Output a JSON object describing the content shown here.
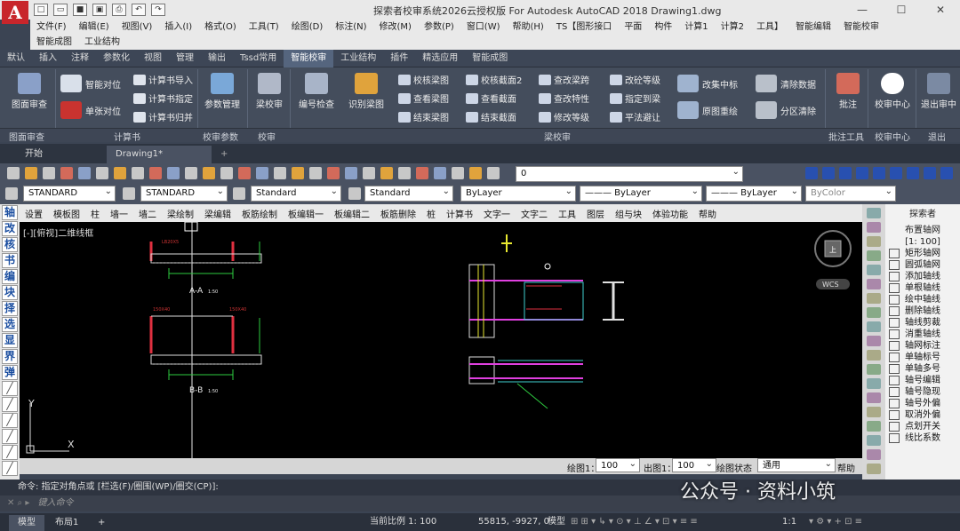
{
  "title": {
    "app_letter": "A",
    "text": "探索者校审系统2026云授权版 For Autodesk AutoCAD 2018    Drawing1.dwg",
    "controls": [
      "—",
      "☐",
      "✕"
    ]
  },
  "menu": {
    "line1": [
      "文件(F)",
      "编辑(E)",
      "视图(V)",
      "插入(I)",
      "格式(O)",
      "工具(T)",
      "绘图(D)",
      "标注(N)",
      "修改(M)",
      "参数(P)",
      "窗口(W)",
      "帮助(H)",
      "TS【图形接口",
      "平面",
      "构件",
      "计算1",
      "计算2",
      "工具】",
      "智能编辑",
      "智能校审"
    ],
    "line2": [
      "智能成图",
      "工业结构"
    ]
  },
  "ribbon_tabs": [
    "默认",
    "插入",
    "注释",
    "参数化",
    "视图",
    "管理",
    "输出",
    "Tssd常用",
    "智能校审",
    "工业结构",
    "插件",
    "精选应用",
    "智能成图"
  ],
  "ribbon_active": "智能校审",
  "ribbon": {
    "b_tumian": "图面审查",
    "b_zhineng": "智能对位",
    "b_danzhang": "单张对位",
    "b_jsdr": "计算书导入",
    "b_jszd": "计算书指定",
    "b_jsgb": "计算书归并",
    "b_cscl": "参数管理",
    "b_liang": "梁校审",
    "b_bhjc": "编号检查",
    "b_sbl": "识别梁图",
    "b_xhlt": "校核梁图",
    "b_ckl": "查看梁图",
    "b_jsl": "结束梁图",
    "b_xhjm": "校核截面2",
    "b_ckjm": "查看截面",
    "b_jsjm": "结束截面",
    "b_ckljz": "查改梁跨",
    "b_cktx": "查改特性",
    "b_xgdj": "修改等级",
    "b_gqdj": "改砼等级",
    "b_zddl": "指定到梁",
    "b_pfbr": "平法避让",
    "b_gjzb": "改集中标",
    "b_yxcl": "原图重绘",
    "b_qcsj": "清除数据",
    "b_fqqc": "分区清除",
    "b_pz": "批注",
    "b_jszx": "校审中心",
    "b_tczx": "退出审中",
    "b_tc": "退出审中心"
  },
  "ribbon_panels": [
    "图面审查",
    "计算书",
    "校审参数",
    "校审",
    "梁校审",
    "批注工具",
    "校审中心",
    "退出"
  ],
  "doc_tabs": [
    "开始",
    "Drawing1*"
  ],
  "toolbar": {
    "layer": "0",
    "styles": [
      "STANDARD",
      "STANDARD",
      "Standard",
      "Standard"
    ],
    "bylayer": [
      "ByLayer",
      "——— ByLayer",
      "——— ByLayer",
      "ByColor"
    ]
  },
  "left_tools": [
    "轴",
    "改",
    "核",
    "书",
    "编",
    "块",
    "择",
    "选",
    "显",
    "界",
    "弹"
  ],
  "cad_menu": [
    "设置",
    "模板图",
    "柱",
    "墙一",
    "墙二",
    "梁绘制",
    "梁编辑",
    "板筋绘制",
    "板编辑一",
    "板编辑二",
    "板筋删除",
    "桩",
    "计算书",
    "文字一",
    "文字二",
    "工具",
    "图层",
    "组与块",
    "体验功能",
    "帮助"
  ],
  "viewport_label": "[-][俯视]二维线框",
  "drawing": {
    "section_a": "A-A",
    "section_a_scale": "1:50",
    "section_b": "B-B",
    "section_b_scale": "1:50",
    "wcs": "WCS",
    "viewcube": "上",
    "axis_y": "Y",
    "axis_x": "X"
  },
  "right_panel": {
    "head1": "探索者",
    "head2": "布置轴网",
    "head3": "[1: 100]",
    "items": [
      "矩形轴网",
      "圆弧轴网",
      "添加轴线",
      "单根轴线",
      "绘中轴线",
      "删除轴线",
      "轴线剪裁",
      "消重轴线",
      "轴网标注",
      "单轴标号",
      "单轴多号",
      "轴号编辑",
      "轴号隐现",
      "轴号外偏",
      "取消外偏",
      "点划开关",
      "线比系数"
    ]
  },
  "scalebar": {
    "label1": "绘图1：",
    "val1": "100",
    "label2": "出图1：",
    "val2": "100",
    "label3": "绘图状态",
    "val3": "通用",
    "help": "帮助"
  },
  "command": {
    "line": "命令: 指定对角点或 [栏选(F)/圈围(WP)/圈交(CP)]:",
    "placeholder": "键入命令"
  },
  "status": {
    "tab_model": "模型",
    "tab_layout": "布局1",
    "plus": "+",
    "scale": "当前比例 1: 100",
    "coords": "55815, -9927, 0",
    "mode": "模型",
    "ratio": "1:1"
  },
  "watermark": "公众号 · 资料小筑"
}
